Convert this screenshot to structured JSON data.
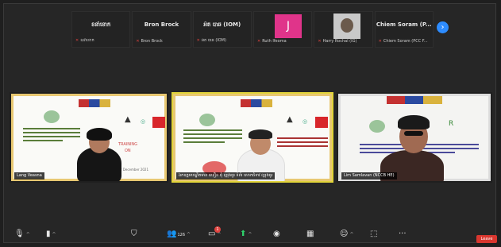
{
  "strip": {
    "tiles": [
      {
        "big": "ខនាំខោក",
        "small": "ឧដាំខោក"
      },
      {
        "big": "Bron Brock",
        "small": "Bron Brock"
      },
      {
        "big": "អ៉ត បាឆ (IOM)",
        "small": "អ៉ត បាឆ (IOM)"
      },
      {
        "avatar": "J",
        "small": "Ruth Ifeoma"
      },
      {
        "big": "",
        "small": "Harry Rochal (IG)"
      },
      {
        "big": "Chiem Soram (P...",
        "small": "Chiem Soram (PCC F..."
      }
    ],
    "next_icon": "chevron-right-icon"
  },
  "panels": [
    {
      "name": "Lang Veasna",
      "label": "រេ..."
    },
    {
      "name": "ឯកឧត្តមបណ្ឌិតមាន ឈឿន ជុំ ល្អរុងធូរ ទំព័រ លោកជំទាវ ល្អរុងធូរ"
    },
    {
      "name": "Lim Samlavan (NCCB HE)"
    }
  ],
  "poster": {
    "title": "TRAINING",
    "subtitle": "ON",
    "date": "1-2 December 2021"
  },
  "toolbar": {
    "participants_count": "126",
    "chat_badge": "1",
    "leave_label": "Leave"
  }
}
